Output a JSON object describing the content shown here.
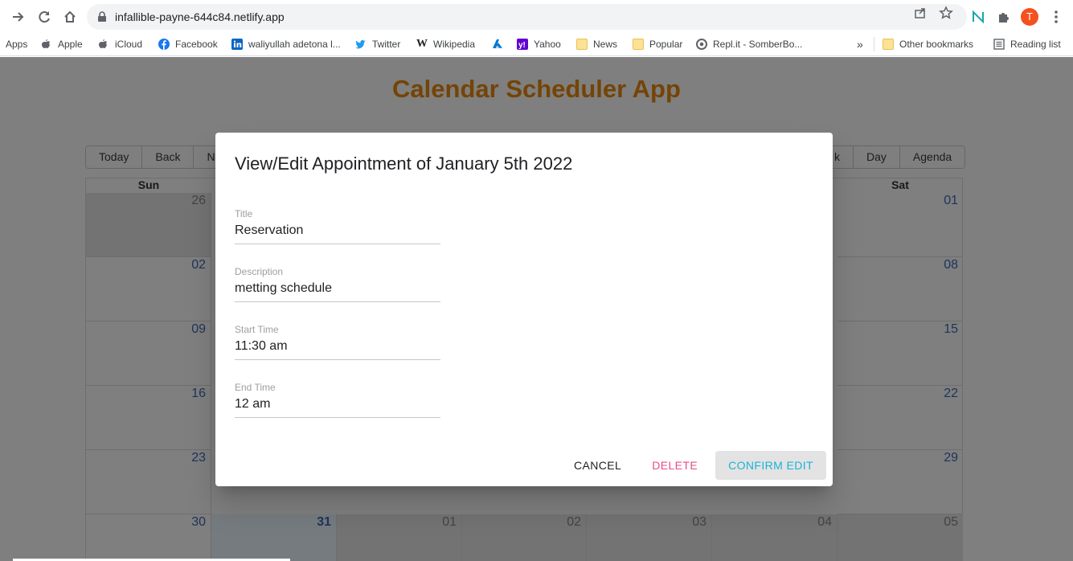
{
  "browser": {
    "url": "infallible-payne-644c84.netlify.app",
    "avatar_letter": "T",
    "bookmarks": [
      {
        "label": "Apps",
        "icon": "apps-grid-icon"
      },
      {
        "label": "Apple",
        "icon": "apple-icon"
      },
      {
        "label": "iCloud",
        "icon": "apple-icon"
      },
      {
        "label": "Facebook",
        "icon": "facebook-icon"
      },
      {
        "label": "waliyullah adetona l...",
        "icon": "linkedin-icon"
      },
      {
        "label": "Twitter",
        "icon": "twitter-icon"
      },
      {
        "label": "Wikipedia",
        "icon": "wikipedia-icon"
      },
      {
        "label": "",
        "icon": "azure-icon"
      },
      {
        "label": "Yahoo",
        "icon": "yahoo-icon"
      },
      {
        "label": "News",
        "icon": "folder-icon"
      },
      {
        "label": "Popular",
        "icon": "folder-icon"
      },
      {
        "label": "Repl.it - SomberBo...",
        "icon": "replit-icon"
      }
    ],
    "overflow_label": "»",
    "other_bookmarks": "Other bookmarks",
    "reading_list": "Reading list"
  },
  "app": {
    "title": "Calendar Scheduler App",
    "toolbar_left": [
      "Today",
      "Back",
      "Ne"
    ],
    "toolbar_right": [
      "k",
      "Day",
      "Agenda"
    ],
    "weekdays": [
      "Sun",
      "Sat"
    ],
    "weeks": [
      [
        "26",
        "01"
      ],
      [
        "02",
        "08"
      ],
      [
        "09",
        "15"
      ],
      [
        "16",
        "22"
      ],
      [
        "23",
        "29"
      ],
      [
        "30",
        "31",
        "01",
        "02",
        "03",
        "04",
        "05"
      ]
    ]
  },
  "dialog": {
    "title": "View/Edit Appointment of January 5th 2022",
    "fields": [
      {
        "label": "Title",
        "value": "Reservation"
      },
      {
        "label": "Description",
        "value": "metting schedule"
      },
      {
        "label": "Start Time",
        "value": "11:30 am"
      },
      {
        "label": "End Time",
        "value": "12 am"
      }
    ],
    "cancel": "CANCEL",
    "delete": "DELETE",
    "confirm": "CONFIRM EDIT"
  },
  "colors": {
    "app_title": "#e8890c",
    "date_number": "#3d6ab5",
    "delete": "#e84d8a",
    "confirm": "#1ab3d6",
    "avatar": "#f4511e"
  }
}
